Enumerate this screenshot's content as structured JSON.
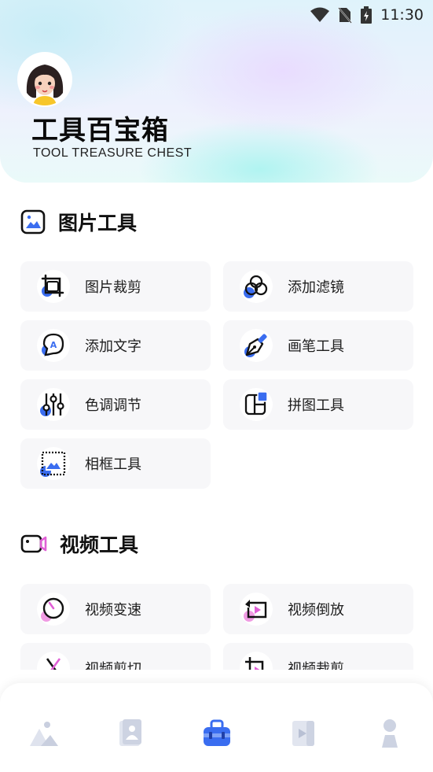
{
  "status": {
    "time": "11:30"
  },
  "header": {
    "title": "工具百宝箱",
    "subtitle": "TOOL TREASURE CHEST"
  },
  "sections": {
    "image": {
      "title": "图片工具",
      "items": [
        "图片裁剪",
        "添加滤镜",
        "添加文字",
        "画笔工具",
        "色调调节",
        "拼图工具",
        "相框工具"
      ]
    },
    "video": {
      "title": "视频工具",
      "items": [
        "视频变速",
        "视频倒放",
        "视频剪切",
        "视频裁剪"
      ]
    }
  },
  "colors": {
    "accent": "#3a6df0",
    "pink": "#e98ad9",
    "icon_dark": "#111111"
  },
  "nav": [
    "home-icon",
    "portrait-icon",
    "toolbox-icon",
    "video-icon",
    "profile-icon"
  ]
}
